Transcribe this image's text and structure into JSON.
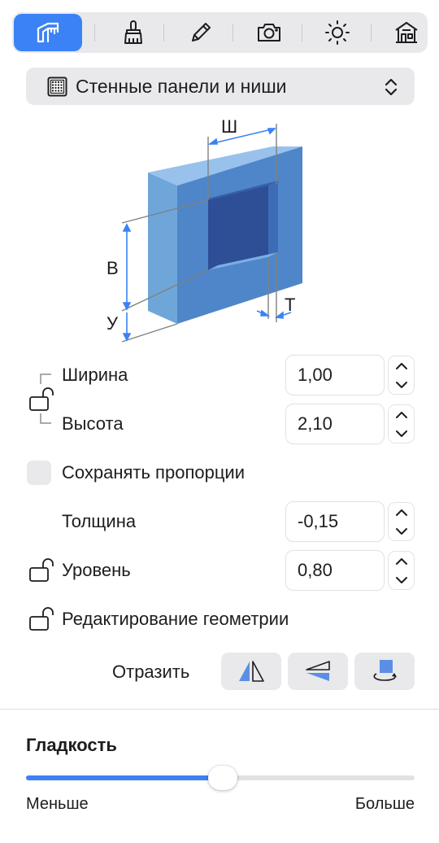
{
  "toolbar": {
    "tabs": [
      {
        "icon": "wall-measure-icon",
        "active": true
      },
      {
        "icon": "brush-icon",
        "active": false
      },
      {
        "icon": "pencil-icon",
        "active": false
      },
      {
        "icon": "camera-icon",
        "active": false
      },
      {
        "icon": "sun-icon",
        "active": false
      },
      {
        "icon": "house-icon",
        "active": false
      }
    ]
  },
  "dropdown": {
    "label": "Стенные панели и ниши",
    "icon": "wall-panel-icon"
  },
  "diagram": {
    "width_label": "Ш",
    "height_label": "В",
    "level_label": "У",
    "thickness_label": "Т"
  },
  "fields": {
    "width": {
      "label": "Ширина",
      "value": "1,00"
    },
    "height": {
      "label": "Высота",
      "value": "2,10"
    },
    "keep_proportions": {
      "label": "Сохранять пропорции",
      "checked": false
    },
    "thickness": {
      "label": "Толщина",
      "value": "-0,15"
    },
    "level": {
      "label": "Уровень",
      "value": "0,80"
    },
    "edit_geometry": {
      "label": "Редактирование геометрии"
    }
  },
  "mirror": {
    "label": "Отразить"
  },
  "smoothness": {
    "title": "Гладкость",
    "min_label": "Меньше",
    "max_label": "Больше",
    "value": 0.5
  },
  "colors": {
    "accent": "#3b82f6",
    "panel_bg": "#e9e9eb"
  }
}
